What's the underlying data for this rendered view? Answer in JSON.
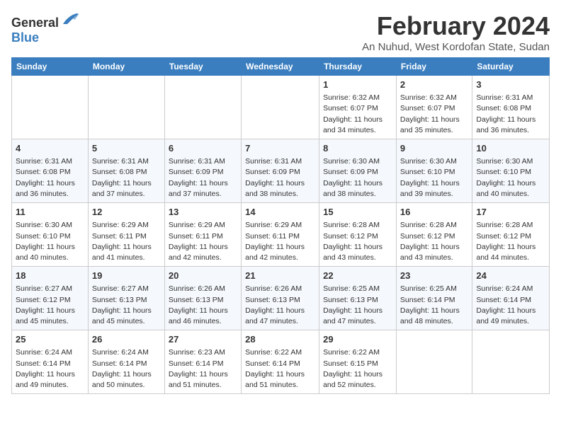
{
  "logo": {
    "general": "General",
    "blue": "Blue"
  },
  "title": "February 2024",
  "subtitle": "An Nuhud, West Kordofan State, Sudan",
  "weekdays": [
    "Sunday",
    "Monday",
    "Tuesday",
    "Wednesday",
    "Thursday",
    "Friday",
    "Saturday"
  ],
  "weeks": [
    [
      {
        "day": "",
        "info": ""
      },
      {
        "day": "",
        "info": ""
      },
      {
        "day": "",
        "info": ""
      },
      {
        "day": "",
        "info": ""
      },
      {
        "day": "1",
        "info": "Sunrise: 6:32 AM\nSunset: 6:07 PM\nDaylight: 11 hours\nand 34 minutes."
      },
      {
        "day": "2",
        "info": "Sunrise: 6:32 AM\nSunset: 6:07 PM\nDaylight: 11 hours\nand 35 minutes."
      },
      {
        "day": "3",
        "info": "Sunrise: 6:31 AM\nSunset: 6:08 PM\nDaylight: 11 hours\nand 36 minutes."
      }
    ],
    [
      {
        "day": "4",
        "info": "Sunrise: 6:31 AM\nSunset: 6:08 PM\nDaylight: 11 hours\nand 36 minutes."
      },
      {
        "day": "5",
        "info": "Sunrise: 6:31 AM\nSunset: 6:08 PM\nDaylight: 11 hours\nand 37 minutes."
      },
      {
        "day": "6",
        "info": "Sunrise: 6:31 AM\nSunset: 6:09 PM\nDaylight: 11 hours\nand 37 minutes."
      },
      {
        "day": "7",
        "info": "Sunrise: 6:31 AM\nSunset: 6:09 PM\nDaylight: 11 hours\nand 38 minutes."
      },
      {
        "day": "8",
        "info": "Sunrise: 6:30 AM\nSunset: 6:09 PM\nDaylight: 11 hours\nand 38 minutes."
      },
      {
        "day": "9",
        "info": "Sunrise: 6:30 AM\nSunset: 6:10 PM\nDaylight: 11 hours\nand 39 minutes."
      },
      {
        "day": "10",
        "info": "Sunrise: 6:30 AM\nSunset: 6:10 PM\nDaylight: 11 hours\nand 40 minutes."
      }
    ],
    [
      {
        "day": "11",
        "info": "Sunrise: 6:30 AM\nSunset: 6:10 PM\nDaylight: 11 hours\nand 40 minutes."
      },
      {
        "day": "12",
        "info": "Sunrise: 6:29 AM\nSunset: 6:11 PM\nDaylight: 11 hours\nand 41 minutes."
      },
      {
        "day": "13",
        "info": "Sunrise: 6:29 AM\nSunset: 6:11 PM\nDaylight: 11 hours\nand 42 minutes."
      },
      {
        "day": "14",
        "info": "Sunrise: 6:29 AM\nSunset: 6:11 PM\nDaylight: 11 hours\nand 42 minutes."
      },
      {
        "day": "15",
        "info": "Sunrise: 6:28 AM\nSunset: 6:12 PM\nDaylight: 11 hours\nand 43 minutes."
      },
      {
        "day": "16",
        "info": "Sunrise: 6:28 AM\nSunset: 6:12 PM\nDaylight: 11 hours\nand 43 minutes."
      },
      {
        "day": "17",
        "info": "Sunrise: 6:28 AM\nSunset: 6:12 PM\nDaylight: 11 hours\nand 44 minutes."
      }
    ],
    [
      {
        "day": "18",
        "info": "Sunrise: 6:27 AM\nSunset: 6:12 PM\nDaylight: 11 hours\nand 45 minutes."
      },
      {
        "day": "19",
        "info": "Sunrise: 6:27 AM\nSunset: 6:13 PM\nDaylight: 11 hours\nand 45 minutes."
      },
      {
        "day": "20",
        "info": "Sunrise: 6:26 AM\nSunset: 6:13 PM\nDaylight: 11 hours\nand 46 minutes."
      },
      {
        "day": "21",
        "info": "Sunrise: 6:26 AM\nSunset: 6:13 PM\nDaylight: 11 hours\nand 47 minutes."
      },
      {
        "day": "22",
        "info": "Sunrise: 6:25 AM\nSunset: 6:13 PM\nDaylight: 11 hours\nand 47 minutes."
      },
      {
        "day": "23",
        "info": "Sunrise: 6:25 AM\nSunset: 6:14 PM\nDaylight: 11 hours\nand 48 minutes."
      },
      {
        "day": "24",
        "info": "Sunrise: 6:24 AM\nSunset: 6:14 PM\nDaylight: 11 hours\nand 49 minutes."
      }
    ],
    [
      {
        "day": "25",
        "info": "Sunrise: 6:24 AM\nSunset: 6:14 PM\nDaylight: 11 hours\nand 49 minutes."
      },
      {
        "day": "26",
        "info": "Sunrise: 6:24 AM\nSunset: 6:14 PM\nDaylight: 11 hours\nand 50 minutes."
      },
      {
        "day": "27",
        "info": "Sunrise: 6:23 AM\nSunset: 6:14 PM\nDaylight: 11 hours\nand 51 minutes."
      },
      {
        "day": "28",
        "info": "Sunrise: 6:22 AM\nSunset: 6:14 PM\nDaylight: 11 hours\nand 51 minutes."
      },
      {
        "day": "29",
        "info": "Sunrise: 6:22 AM\nSunset: 6:15 PM\nDaylight: 11 hours\nand 52 minutes."
      },
      {
        "day": "",
        "info": ""
      },
      {
        "day": "",
        "info": ""
      }
    ]
  ]
}
